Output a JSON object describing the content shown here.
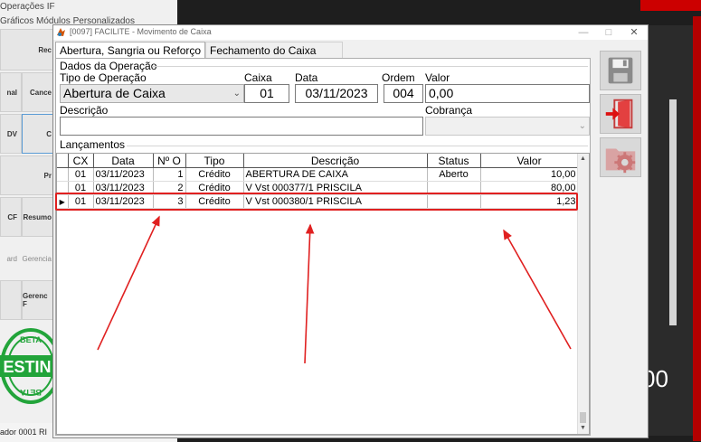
{
  "background_app": {
    "title": "Operações IF",
    "menu": "Gráficos   Módulos Personalizados",
    "buttons": [
      "Rec",
      "nal",
      "Cance",
      "DV",
      "C",
      "Pr",
      "CF",
      "Resumo",
      "ard",
      "Gerencia",
      "Gerenc F"
    ],
    "footer": "ador  0001    RI",
    "big_number": "00",
    "stamp_text": [
      "BETA",
      "ESTIN",
      "BETA"
    ]
  },
  "dialog": {
    "title": "[0097] FACILITE - Movimento de Caixa",
    "window_buttons": [
      "—",
      "□",
      "✕"
    ],
    "tabs": [
      {
        "label": "Abertura, Sangria ou Reforço",
        "active": true
      },
      {
        "label": "Fechamento do Caixa",
        "active": false
      }
    ]
  },
  "form": {
    "group_operacao": "Dados da Operação",
    "tipo_label": "Tipo de Operação",
    "tipo_value": "Abertura de Caixa",
    "caixa_label": "Caixa",
    "caixa_value": "01",
    "data_label": "Data",
    "data_value": "03/11/2023",
    "ordem_label": "Ordem",
    "ordem_value": "004",
    "valor_label": "Valor",
    "valor_value": "0,00",
    "descricao_label": "Descrição",
    "descricao_value": "",
    "cobranca_label": "Cobrança",
    "cobranca_value": "",
    "group_lancamentos": "Lançamentos"
  },
  "grid": {
    "columns": [
      "CX",
      "Data",
      "Nº O",
      "Tipo",
      "Descrição",
      "Status",
      "Valor"
    ],
    "rows": [
      {
        "cx": "01",
        "data": "03/11/2023",
        "num": "1",
        "tipo": "Crédito",
        "descricao": "ABERTURA DE CAIXA",
        "status": "Aberto",
        "valor": "10,00",
        "current": false
      },
      {
        "cx": "01",
        "data": "03/11/2023",
        "num": "2",
        "tipo": "Crédito",
        "descricao": "V Vst 000377/1 PRISCILA",
        "status": "",
        "valor": "80,00",
        "current": false
      },
      {
        "cx": "01",
        "data": "03/11/2023",
        "num": "3",
        "tipo": "Crédito",
        "descricao": "V Vst 000380/1 PRISCILA",
        "status": "",
        "valor": "1,23",
        "current": true
      }
    ]
  },
  "side_buttons": [
    "save-icon",
    "exit-door-icon",
    "settings-folder-icon"
  ],
  "colors": {
    "highlight": "#e02020",
    "accent_red": "#c00000"
  }
}
